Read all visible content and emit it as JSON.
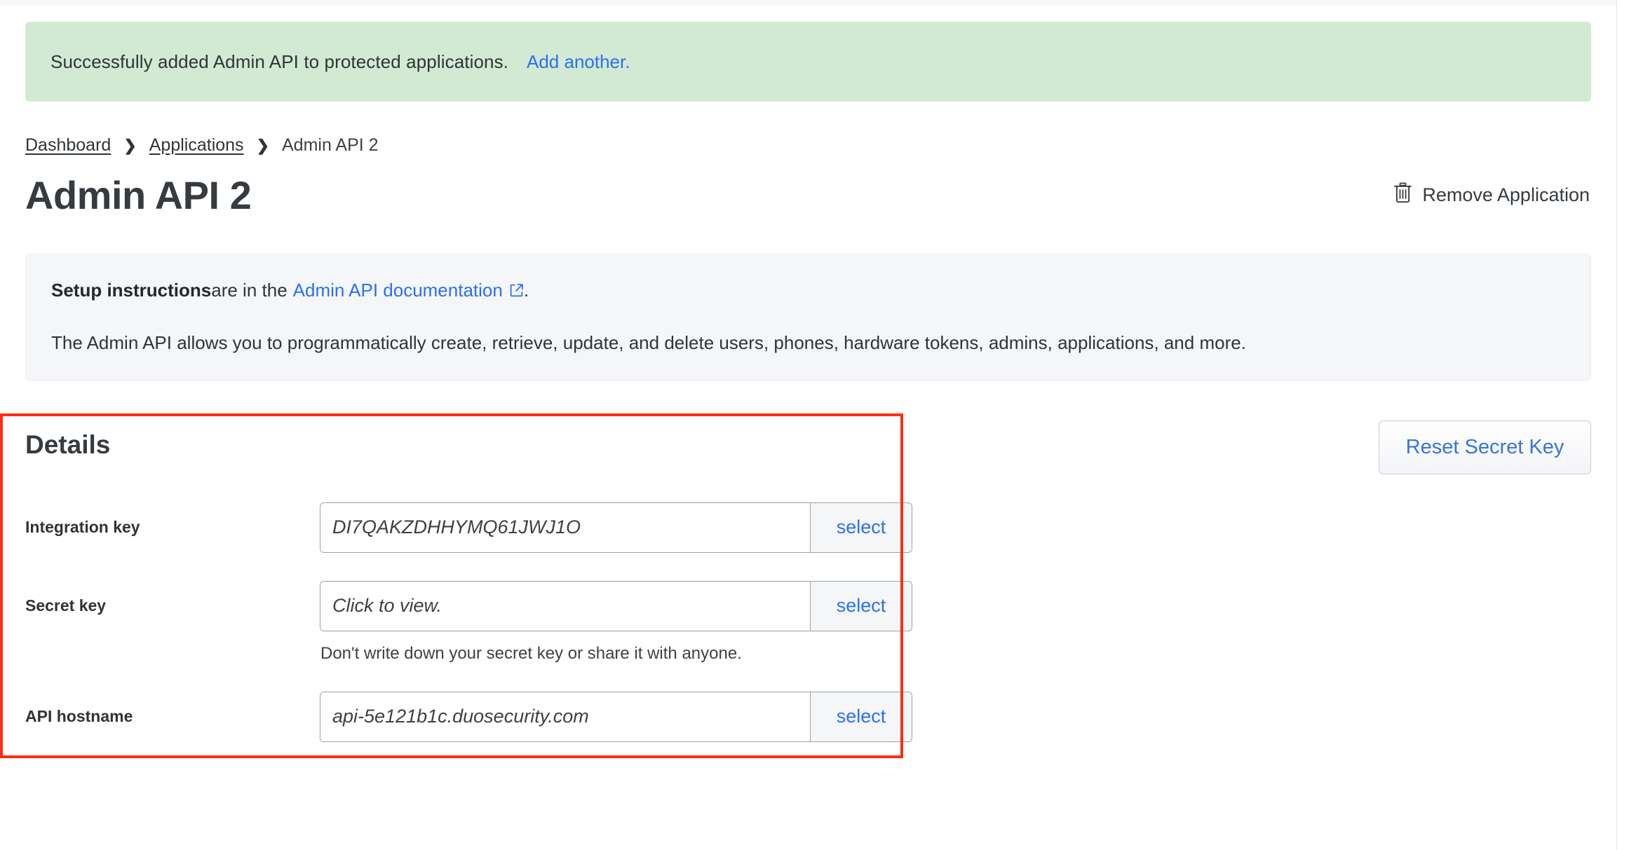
{
  "banner": {
    "message": "Successfully added Admin API to protected applications.",
    "link_label": "Add another.",
    "background_color": "#d2ead3",
    "link_color": "#2b6ff2"
  },
  "breadcrumb": {
    "items": [
      {
        "label": "Dashboard",
        "link": true
      },
      {
        "label": "Applications",
        "link": true
      },
      {
        "label": "Admin API 2",
        "link": false
      }
    ],
    "separator": "❯"
  },
  "header": {
    "title": "Admin API 2",
    "remove_button_label": "Remove Application",
    "remove_button_icon": "trash-icon"
  },
  "info_box": {
    "setup_strong": "Setup instructions",
    "setup_rest": " are in the",
    "doc_link_label": "Admin API documentation",
    "doc_link_icon": "external-link-icon",
    "setup_period": ".",
    "description": "The Admin API allows you to programmatically create, retrieve, update, and delete users, phones, hardware tokens, admins, applications, and more.",
    "background_color": "#f5f6f8"
  },
  "details": {
    "section_title": "Details",
    "reset_button_label": "Reset Secret Key",
    "highlight_color": "#ff2d10",
    "fields": [
      {
        "label": "Integration key",
        "value": "DI7QAKZDHHYMQ61JWJ1O",
        "action_label": "select",
        "help": ""
      },
      {
        "label": "Secret key",
        "value": "Click to view.",
        "action_label": "select",
        "help": "Don't write down your secret key or share it with anyone."
      },
      {
        "label": "API hostname",
        "value": "api-5e121b1c.duosecurity.com",
        "action_label": "select",
        "help": ""
      }
    ]
  }
}
